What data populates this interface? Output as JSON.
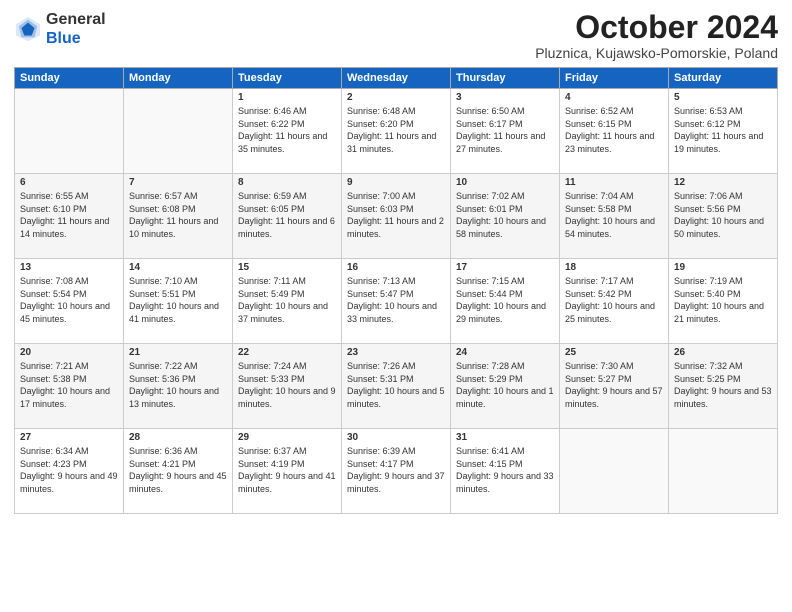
{
  "logo": {
    "general": "General",
    "blue": "Blue"
  },
  "header": {
    "month": "October 2024",
    "location": "Pluznica, Kujawsko-Pomorskie, Poland"
  },
  "weekdays": [
    "Sunday",
    "Monday",
    "Tuesday",
    "Wednesday",
    "Thursday",
    "Friday",
    "Saturday"
  ],
  "weeks": [
    [
      {
        "day": "",
        "sunrise": "",
        "sunset": "",
        "daylight": ""
      },
      {
        "day": "",
        "sunrise": "",
        "sunset": "",
        "daylight": ""
      },
      {
        "day": "1",
        "sunrise": "Sunrise: 6:46 AM",
        "sunset": "Sunset: 6:22 PM",
        "daylight": "Daylight: 11 hours and 35 minutes."
      },
      {
        "day": "2",
        "sunrise": "Sunrise: 6:48 AM",
        "sunset": "Sunset: 6:20 PM",
        "daylight": "Daylight: 11 hours and 31 minutes."
      },
      {
        "day": "3",
        "sunrise": "Sunrise: 6:50 AM",
        "sunset": "Sunset: 6:17 PM",
        "daylight": "Daylight: 11 hours and 27 minutes."
      },
      {
        "day": "4",
        "sunrise": "Sunrise: 6:52 AM",
        "sunset": "Sunset: 6:15 PM",
        "daylight": "Daylight: 11 hours and 23 minutes."
      },
      {
        "day": "5",
        "sunrise": "Sunrise: 6:53 AM",
        "sunset": "Sunset: 6:12 PM",
        "daylight": "Daylight: 11 hours and 19 minutes."
      }
    ],
    [
      {
        "day": "6",
        "sunrise": "Sunrise: 6:55 AM",
        "sunset": "Sunset: 6:10 PM",
        "daylight": "Daylight: 11 hours and 14 minutes."
      },
      {
        "day": "7",
        "sunrise": "Sunrise: 6:57 AM",
        "sunset": "Sunset: 6:08 PM",
        "daylight": "Daylight: 11 hours and 10 minutes."
      },
      {
        "day": "8",
        "sunrise": "Sunrise: 6:59 AM",
        "sunset": "Sunset: 6:05 PM",
        "daylight": "Daylight: 11 hours and 6 minutes."
      },
      {
        "day": "9",
        "sunrise": "Sunrise: 7:00 AM",
        "sunset": "Sunset: 6:03 PM",
        "daylight": "Daylight: 11 hours and 2 minutes."
      },
      {
        "day": "10",
        "sunrise": "Sunrise: 7:02 AM",
        "sunset": "Sunset: 6:01 PM",
        "daylight": "Daylight: 10 hours and 58 minutes."
      },
      {
        "day": "11",
        "sunrise": "Sunrise: 7:04 AM",
        "sunset": "Sunset: 5:58 PM",
        "daylight": "Daylight: 10 hours and 54 minutes."
      },
      {
        "day": "12",
        "sunrise": "Sunrise: 7:06 AM",
        "sunset": "Sunset: 5:56 PM",
        "daylight": "Daylight: 10 hours and 50 minutes."
      }
    ],
    [
      {
        "day": "13",
        "sunrise": "Sunrise: 7:08 AM",
        "sunset": "Sunset: 5:54 PM",
        "daylight": "Daylight: 10 hours and 45 minutes."
      },
      {
        "day": "14",
        "sunrise": "Sunrise: 7:10 AM",
        "sunset": "Sunset: 5:51 PM",
        "daylight": "Daylight: 10 hours and 41 minutes."
      },
      {
        "day": "15",
        "sunrise": "Sunrise: 7:11 AM",
        "sunset": "Sunset: 5:49 PM",
        "daylight": "Daylight: 10 hours and 37 minutes."
      },
      {
        "day": "16",
        "sunrise": "Sunrise: 7:13 AM",
        "sunset": "Sunset: 5:47 PM",
        "daylight": "Daylight: 10 hours and 33 minutes."
      },
      {
        "day": "17",
        "sunrise": "Sunrise: 7:15 AM",
        "sunset": "Sunset: 5:44 PM",
        "daylight": "Daylight: 10 hours and 29 minutes."
      },
      {
        "day": "18",
        "sunrise": "Sunrise: 7:17 AM",
        "sunset": "Sunset: 5:42 PM",
        "daylight": "Daylight: 10 hours and 25 minutes."
      },
      {
        "day": "19",
        "sunrise": "Sunrise: 7:19 AM",
        "sunset": "Sunset: 5:40 PM",
        "daylight": "Daylight: 10 hours and 21 minutes."
      }
    ],
    [
      {
        "day": "20",
        "sunrise": "Sunrise: 7:21 AM",
        "sunset": "Sunset: 5:38 PM",
        "daylight": "Daylight: 10 hours and 17 minutes."
      },
      {
        "day": "21",
        "sunrise": "Sunrise: 7:22 AM",
        "sunset": "Sunset: 5:36 PM",
        "daylight": "Daylight: 10 hours and 13 minutes."
      },
      {
        "day": "22",
        "sunrise": "Sunrise: 7:24 AM",
        "sunset": "Sunset: 5:33 PM",
        "daylight": "Daylight: 10 hours and 9 minutes."
      },
      {
        "day": "23",
        "sunrise": "Sunrise: 7:26 AM",
        "sunset": "Sunset: 5:31 PM",
        "daylight": "Daylight: 10 hours and 5 minutes."
      },
      {
        "day": "24",
        "sunrise": "Sunrise: 7:28 AM",
        "sunset": "Sunset: 5:29 PM",
        "daylight": "Daylight: 10 hours and 1 minute."
      },
      {
        "day": "25",
        "sunrise": "Sunrise: 7:30 AM",
        "sunset": "Sunset: 5:27 PM",
        "daylight": "Daylight: 9 hours and 57 minutes."
      },
      {
        "day": "26",
        "sunrise": "Sunrise: 7:32 AM",
        "sunset": "Sunset: 5:25 PM",
        "daylight": "Daylight: 9 hours and 53 minutes."
      }
    ],
    [
      {
        "day": "27",
        "sunrise": "Sunrise: 6:34 AM",
        "sunset": "Sunset: 4:23 PM",
        "daylight": "Daylight: 9 hours and 49 minutes."
      },
      {
        "day": "28",
        "sunrise": "Sunrise: 6:36 AM",
        "sunset": "Sunset: 4:21 PM",
        "daylight": "Daylight: 9 hours and 45 minutes."
      },
      {
        "day": "29",
        "sunrise": "Sunrise: 6:37 AM",
        "sunset": "Sunset: 4:19 PM",
        "daylight": "Daylight: 9 hours and 41 minutes."
      },
      {
        "day": "30",
        "sunrise": "Sunrise: 6:39 AM",
        "sunset": "Sunset: 4:17 PM",
        "daylight": "Daylight: 9 hours and 37 minutes."
      },
      {
        "day": "31",
        "sunrise": "Sunrise: 6:41 AM",
        "sunset": "Sunset: 4:15 PM",
        "daylight": "Daylight: 9 hours and 33 minutes."
      },
      {
        "day": "",
        "sunrise": "",
        "sunset": "",
        "daylight": ""
      },
      {
        "day": "",
        "sunrise": "",
        "sunset": "",
        "daylight": ""
      }
    ]
  ]
}
